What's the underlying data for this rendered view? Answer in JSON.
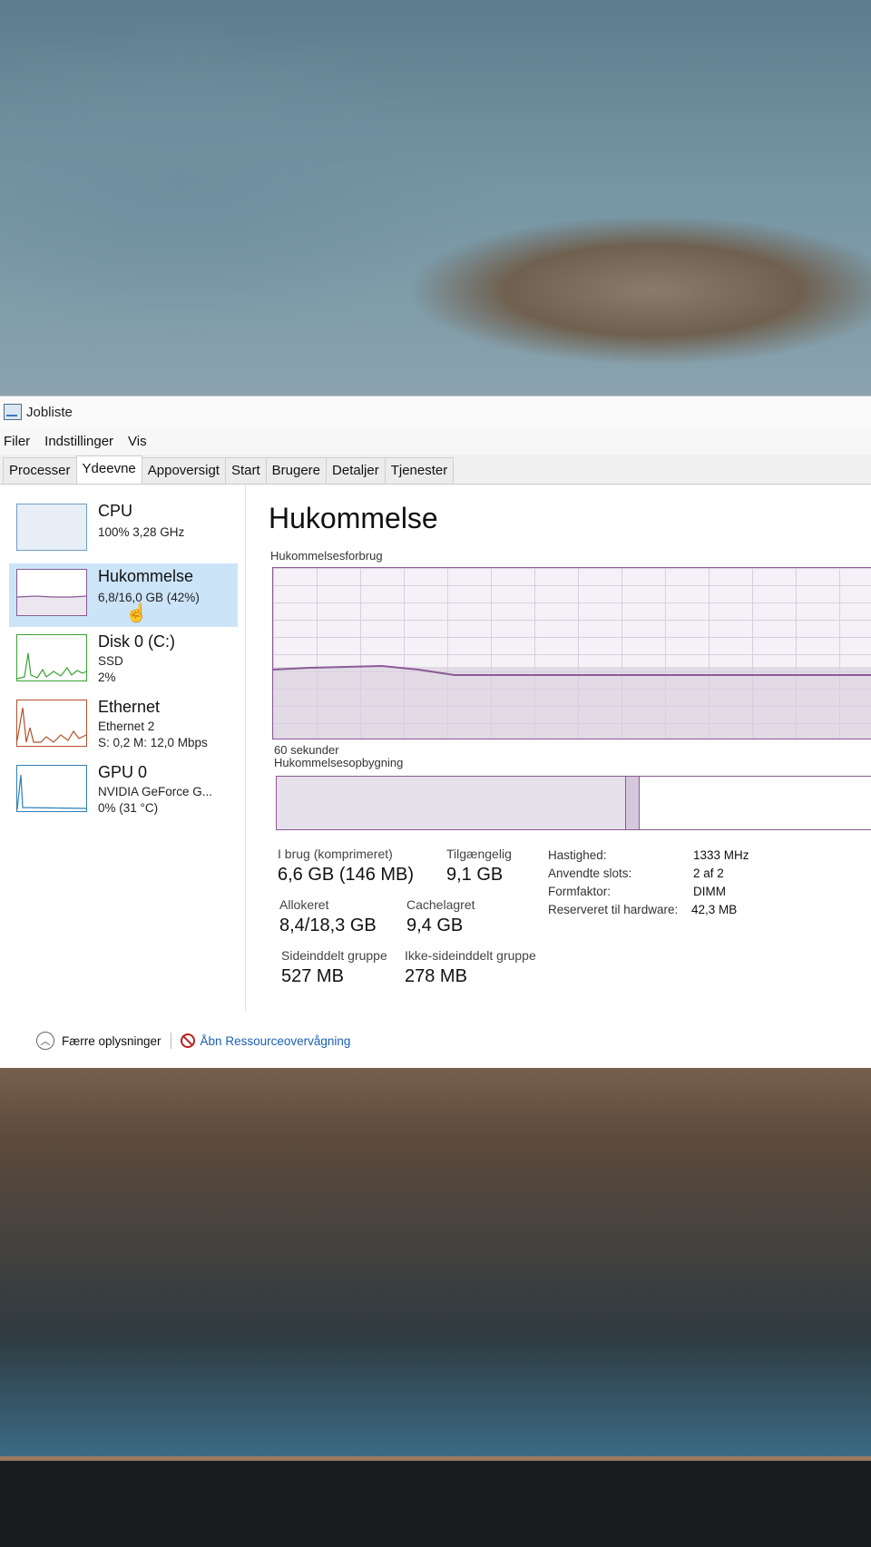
{
  "window": {
    "title": "Jobliste"
  },
  "menu": [
    "Filer",
    "Indstillinger",
    "Vis"
  ],
  "tabs": [
    "Processer",
    "Ydeevne",
    "Appoversigt",
    "Start",
    "Brugere",
    "Detaljer",
    "Tjenester"
  ],
  "active_tab": 1,
  "sidebar": [
    {
      "name": "CPU",
      "sub1": "100% 3,28 GHz"
    },
    {
      "name": "Hukommelse",
      "sub1": "6,8/16,0 GB (42%)"
    },
    {
      "name": "Disk 0 (C:)",
      "sub1": "SSD",
      "sub2": "2%"
    },
    {
      "name": "Ethernet",
      "sub1": "Ethernet 2",
      "sub2": "S: 0,2 M: 12,0 Mbps"
    },
    {
      "name": "GPU 0",
      "sub1": "NVIDIA GeForce G...",
      "sub2": "0% (31 °C)"
    }
  ],
  "main": {
    "title": "Hukommelse",
    "usage_label": "Hukommelsesforbrug",
    "time_label": "60 sekunder",
    "composition_label": "Hukommelsesopbygning",
    "usage_fraction": 0.42
  },
  "stats": {
    "in_use_label": "I brug (komprimeret)",
    "in_use_value": "6,6 GB (146 MB)",
    "available_label": "Tilgængelig",
    "available_value": "9,1 GB",
    "committed_label": "Allokeret",
    "committed_value": "8,4/18,3 GB",
    "cached_label": "Cachelagret",
    "cached_value": "9,4 GB",
    "paged_label": "Sideinddelt gruppe",
    "paged_value": "527 MB",
    "nonpaged_label": "Ikke-sideinddelt gruppe",
    "nonpaged_value": "278 MB"
  },
  "specs": {
    "speed_label": "Hastighed:",
    "speed_value": "1333 MHz",
    "slots_label": "Anvendte slots:",
    "slots_value": "2 af 2",
    "form_label": "Formfaktor:",
    "form_value": "DIMM",
    "reserved_label": "Reserveret til hardware:",
    "reserved_value": "42,3 MB"
  },
  "footer": {
    "fewer_details": "Færre oplysninger",
    "resource_monitor": "Åbn Ressourceovervågning"
  },
  "colors": {
    "memory_accent": "#8b5a96",
    "selection": "#cce4f7",
    "disk": "#3aa232",
    "ethernet": "#b5502a",
    "gpu": "#2f7fb8"
  }
}
